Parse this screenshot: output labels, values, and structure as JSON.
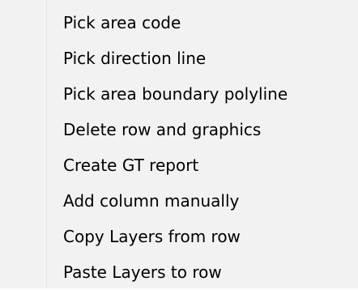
{
  "menu": {
    "items": [
      {
        "label": "Pick area code"
      },
      {
        "label": "Pick direction line"
      },
      {
        "label": "Pick area boundary polyline"
      },
      {
        "label": "Delete row and graphics"
      },
      {
        "label": "Create GT report"
      },
      {
        "label": "Add column manually"
      },
      {
        "label": "Copy Layers from row"
      },
      {
        "label": "Paste Layers to row"
      }
    ]
  }
}
